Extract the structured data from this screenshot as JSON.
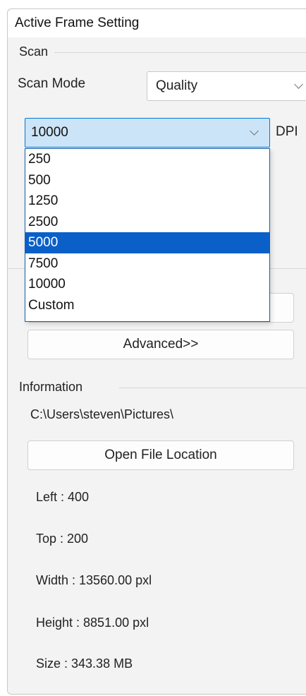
{
  "window": {
    "title": "Active Frame Setting"
  },
  "scan": {
    "group_label": "Scan",
    "scan_mode_label": "Scan Mode",
    "scan_mode_value": "Quality",
    "dpi_value": "10000",
    "dpi_unit": "DPI",
    "dpi_options": [
      "250",
      "500",
      "1250",
      "2500",
      "5000",
      "7500",
      "10000",
      "Custom"
    ],
    "dpi_highlighted": "5000"
  },
  "buttons": {
    "advanced_label": "Advanced>>",
    "open_file_location_label": "Open File Location"
  },
  "information": {
    "group_label": "Information",
    "path": "C:\\Users\\steven\\Pictures\\",
    "left": "Left : 400",
    "top": "Top : 200",
    "width": "Width : 13560.00 pxl",
    "height": "Height : 8851.00 pxl",
    "size": "Size : 343.38 MB"
  },
  "colors": {
    "dropdown_border": "#0f5fb0",
    "highlight": "#0a60c8",
    "combo_focus_bg": "#cce4f7"
  }
}
